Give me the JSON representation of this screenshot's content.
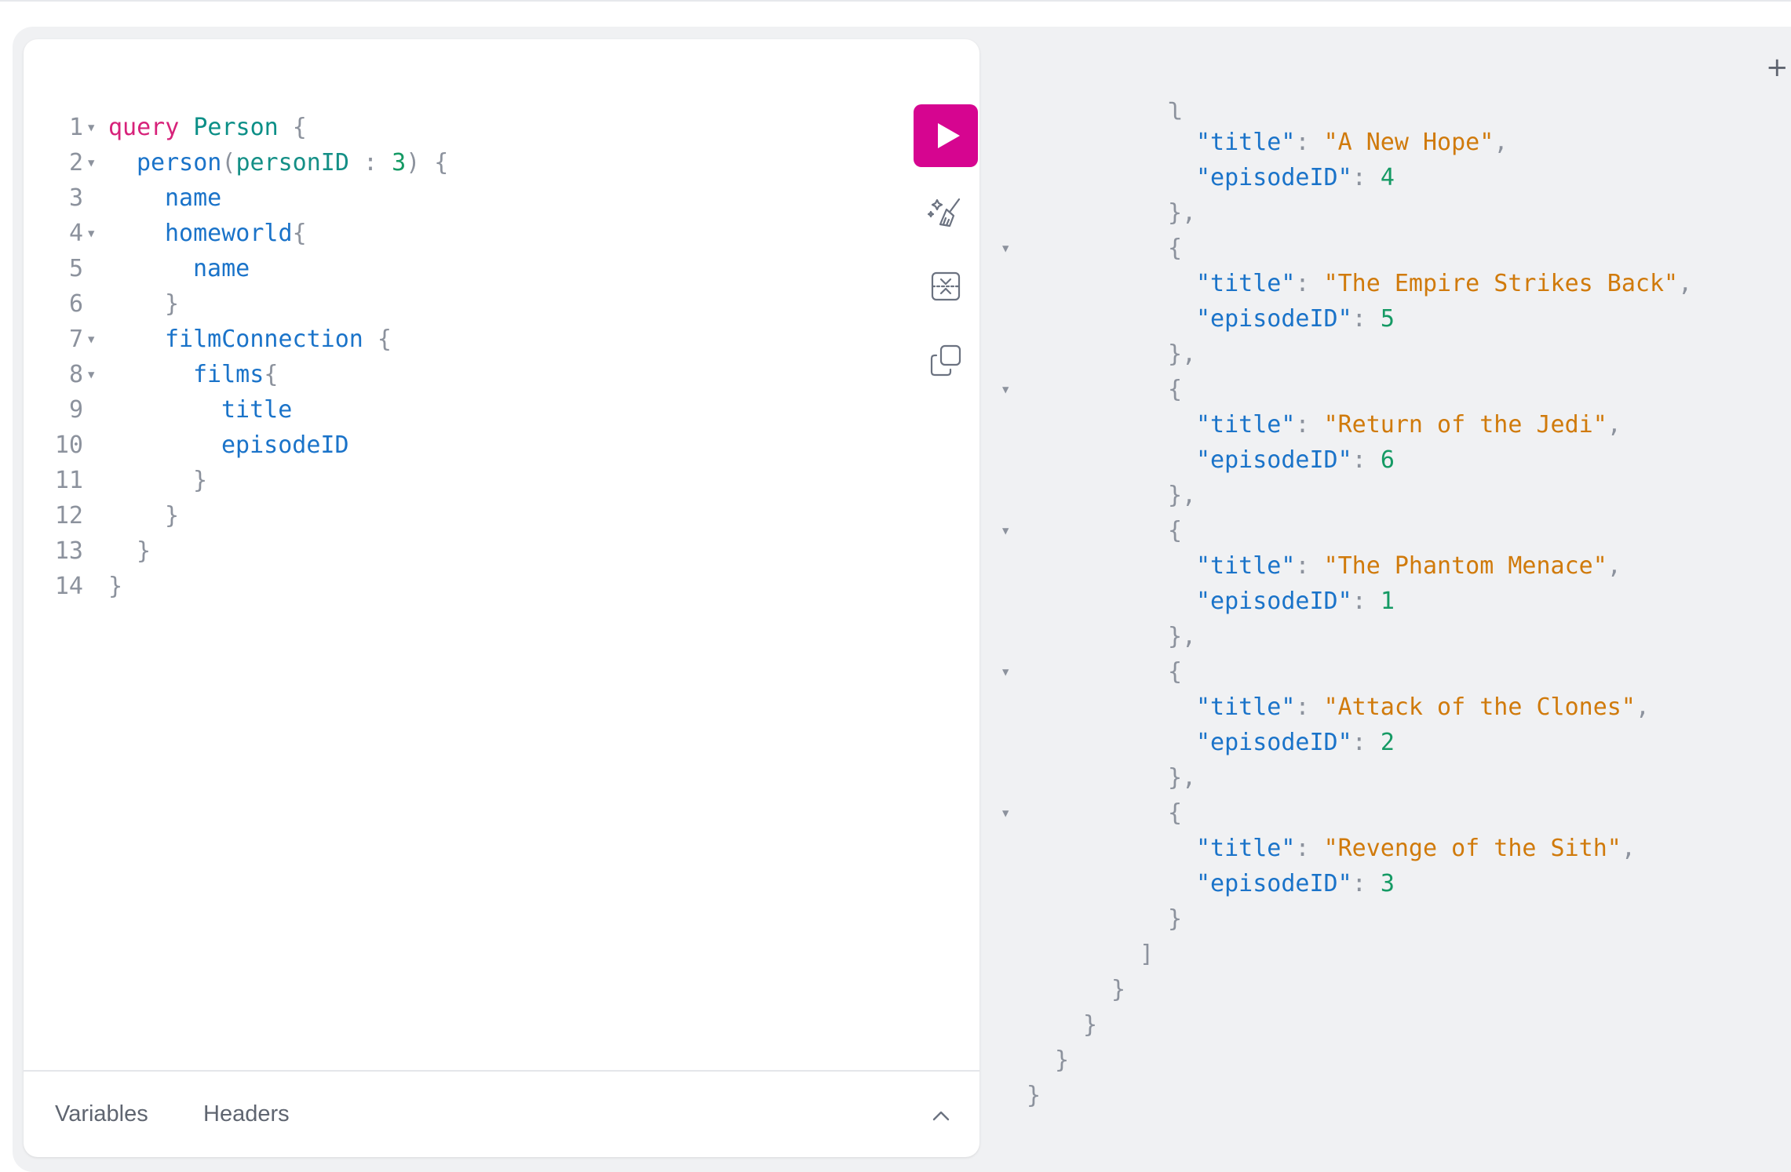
{
  "editor": {
    "lines": [
      {
        "n": "1",
        "fold": true,
        "indent": 0,
        "tokens": [
          {
            "t": "query",
            "c": "kw"
          },
          {
            "t": " ",
            "c": "pu"
          },
          {
            "t": "Person",
            "c": "tn"
          },
          {
            "t": " {",
            "c": "pu"
          }
        ]
      },
      {
        "n": "2",
        "fold": true,
        "indent": 1,
        "tokens": [
          {
            "t": "person",
            "c": "fd"
          },
          {
            "t": "(",
            "c": "pu"
          },
          {
            "t": "personID",
            "c": "ar"
          },
          {
            "t": " : ",
            "c": "pu"
          },
          {
            "t": "3",
            "c": "nm"
          },
          {
            "t": ") {",
            "c": "pu"
          }
        ]
      },
      {
        "n": "3",
        "fold": false,
        "indent": 2,
        "tokens": [
          {
            "t": "name",
            "c": "fd"
          }
        ]
      },
      {
        "n": "4",
        "fold": true,
        "indent": 2,
        "tokens": [
          {
            "t": "homeworld",
            "c": "fd"
          },
          {
            "t": "{",
            "c": "pu"
          }
        ]
      },
      {
        "n": "5",
        "fold": false,
        "indent": 3,
        "tokens": [
          {
            "t": "name",
            "c": "fd"
          }
        ]
      },
      {
        "n": "6",
        "fold": false,
        "indent": 2,
        "tokens": [
          {
            "t": "}",
            "c": "pu"
          }
        ]
      },
      {
        "n": "7",
        "fold": true,
        "indent": 2,
        "tokens": [
          {
            "t": "filmConnection",
            "c": "fd"
          },
          {
            "t": " {",
            "c": "pu"
          }
        ]
      },
      {
        "n": "8",
        "fold": true,
        "indent": 3,
        "tokens": [
          {
            "t": "films",
            "c": "fd"
          },
          {
            "t": "{",
            "c": "pu"
          }
        ]
      },
      {
        "n": "9",
        "fold": false,
        "indent": 4,
        "tokens": [
          {
            "t": "title",
            "c": "fd"
          }
        ]
      },
      {
        "n": "10",
        "fold": false,
        "indent": 4,
        "tokens": [
          {
            "t": "episodeID",
            "c": "fd"
          }
        ]
      },
      {
        "n": "11",
        "fold": false,
        "indent": 3,
        "tokens": [
          {
            "t": "}",
            "c": "pu"
          }
        ]
      },
      {
        "n": "12",
        "fold": false,
        "indent": 2,
        "tokens": [
          {
            "t": "}",
            "c": "pu"
          }
        ]
      },
      {
        "n": "13",
        "fold": false,
        "indent": 1,
        "tokens": [
          {
            "t": "}",
            "c": "pu"
          }
        ]
      },
      {
        "n": "14",
        "fold": false,
        "indent": 0,
        "tokens": [
          {
            "t": "}",
            "c": "pu"
          }
        ]
      }
    ]
  },
  "toolbar": {
    "run_icon": "play-icon",
    "prettify_icon": "magic-broom-icon",
    "merge_icon": "merge-fragments-icon",
    "copy_icon": "copy-icon"
  },
  "bottom_tabs": {
    "variables": "Variables",
    "headers": "Headers",
    "toggle_icon": "chevron-up-icon"
  },
  "result": {
    "add_tab_label": "+",
    "lines": [
      {
        "fold": false,
        "indent": 5,
        "tokens": [
          {
            "t": "ʅ",
            "c": "pu"
          }
        ]
      },
      {
        "fold": false,
        "indent": 6,
        "tokens": [
          {
            "t": "\"title\"",
            "c": "fd"
          },
          {
            "t": ": ",
            "c": "pu"
          },
          {
            "t": "\"A New Hope\"",
            "c": "st"
          },
          {
            "t": ",",
            "c": "pu"
          }
        ]
      },
      {
        "fold": false,
        "indent": 6,
        "tokens": [
          {
            "t": "\"episodeID\"",
            "c": "fd"
          },
          {
            "t": ": ",
            "c": "pu"
          },
          {
            "t": "4",
            "c": "nm"
          }
        ]
      },
      {
        "fold": false,
        "indent": 5,
        "tokens": [
          {
            "t": "},",
            "c": "pu"
          }
        ]
      },
      {
        "fold": true,
        "indent": 5,
        "tokens": [
          {
            "t": "{",
            "c": "pu"
          }
        ]
      },
      {
        "fold": false,
        "indent": 6,
        "tokens": [
          {
            "t": "\"title\"",
            "c": "fd"
          },
          {
            "t": ": ",
            "c": "pu"
          },
          {
            "t": "\"The Empire Strikes Back\"",
            "c": "st"
          },
          {
            "t": ",",
            "c": "pu"
          }
        ]
      },
      {
        "fold": false,
        "indent": 6,
        "tokens": [
          {
            "t": "\"episodeID\"",
            "c": "fd"
          },
          {
            "t": ": ",
            "c": "pu"
          },
          {
            "t": "5",
            "c": "nm"
          }
        ]
      },
      {
        "fold": false,
        "indent": 5,
        "tokens": [
          {
            "t": "},",
            "c": "pu"
          }
        ]
      },
      {
        "fold": true,
        "indent": 5,
        "tokens": [
          {
            "t": "{",
            "c": "pu"
          }
        ]
      },
      {
        "fold": false,
        "indent": 6,
        "tokens": [
          {
            "t": "\"title\"",
            "c": "fd"
          },
          {
            "t": ": ",
            "c": "pu"
          },
          {
            "t": "\"Return of the Jedi\"",
            "c": "st"
          },
          {
            "t": ",",
            "c": "pu"
          }
        ]
      },
      {
        "fold": false,
        "indent": 6,
        "tokens": [
          {
            "t": "\"episodeID\"",
            "c": "fd"
          },
          {
            "t": ": ",
            "c": "pu"
          },
          {
            "t": "6",
            "c": "nm"
          }
        ]
      },
      {
        "fold": false,
        "indent": 5,
        "tokens": [
          {
            "t": "},",
            "c": "pu"
          }
        ]
      },
      {
        "fold": true,
        "indent": 5,
        "tokens": [
          {
            "t": "{",
            "c": "pu"
          }
        ]
      },
      {
        "fold": false,
        "indent": 6,
        "tokens": [
          {
            "t": "\"title\"",
            "c": "fd"
          },
          {
            "t": ": ",
            "c": "pu"
          },
          {
            "t": "\"The Phantom Menace\"",
            "c": "st"
          },
          {
            "t": ",",
            "c": "pu"
          }
        ]
      },
      {
        "fold": false,
        "indent": 6,
        "tokens": [
          {
            "t": "\"episodeID\"",
            "c": "fd"
          },
          {
            "t": ": ",
            "c": "pu"
          },
          {
            "t": "1",
            "c": "nm"
          }
        ]
      },
      {
        "fold": false,
        "indent": 5,
        "tokens": [
          {
            "t": "},",
            "c": "pu"
          }
        ]
      },
      {
        "fold": true,
        "indent": 5,
        "tokens": [
          {
            "t": "{",
            "c": "pu"
          }
        ]
      },
      {
        "fold": false,
        "indent": 6,
        "tokens": [
          {
            "t": "\"title\"",
            "c": "fd"
          },
          {
            "t": ": ",
            "c": "pu"
          },
          {
            "t": "\"Attack of the Clones\"",
            "c": "st"
          },
          {
            "t": ",",
            "c": "pu"
          }
        ]
      },
      {
        "fold": false,
        "indent": 6,
        "tokens": [
          {
            "t": "\"episodeID\"",
            "c": "fd"
          },
          {
            "t": ": ",
            "c": "pu"
          },
          {
            "t": "2",
            "c": "nm"
          }
        ]
      },
      {
        "fold": false,
        "indent": 5,
        "tokens": [
          {
            "t": "},",
            "c": "pu"
          }
        ]
      },
      {
        "fold": true,
        "indent": 5,
        "tokens": [
          {
            "t": "{",
            "c": "pu"
          }
        ]
      },
      {
        "fold": false,
        "indent": 6,
        "tokens": [
          {
            "t": "\"title\"",
            "c": "fd"
          },
          {
            "t": ": ",
            "c": "pu"
          },
          {
            "t": "\"Revenge of the Sith\"",
            "c": "st"
          },
          {
            "t": ",",
            "c": "pu"
          }
        ]
      },
      {
        "fold": false,
        "indent": 6,
        "tokens": [
          {
            "t": "\"episodeID\"",
            "c": "fd"
          },
          {
            "t": ": ",
            "c": "pu"
          },
          {
            "t": "3",
            "c": "nm"
          }
        ]
      },
      {
        "fold": false,
        "indent": 5,
        "tokens": [
          {
            "t": "}",
            "c": "pu"
          }
        ]
      },
      {
        "fold": false,
        "indent": 4,
        "tokens": [
          {
            "t": "]",
            "c": "pu"
          }
        ]
      },
      {
        "fold": false,
        "indent": 3,
        "tokens": [
          {
            "t": "}",
            "c": "pu"
          }
        ]
      },
      {
        "fold": false,
        "indent": 2,
        "tokens": [
          {
            "t": "}",
            "c": "pu"
          }
        ]
      },
      {
        "fold": false,
        "indent": 1,
        "tokens": [
          {
            "t": "}",
            "c": "pu"
          }
        ]
      },
      {
        "fold": false,
        "indent": 0,
        "tokens": [
          {
            "t": "}",
            "c": "pu"
          }
        ]
      }
    ]
  },
  "colors": {
    "run_button": "#d60590",
    "keyword": "#d7227a",
    "field": "#1a73c9",
    "string": "#d07a0b",
    "number": "#159a64",
    "punctuation": "#8c929d"
  }
}
